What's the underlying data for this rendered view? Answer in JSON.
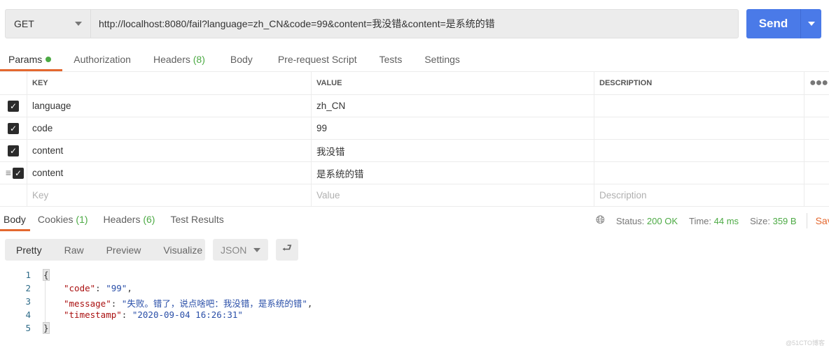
{
  "request": {
    "method": "GET",
    "url": "http://localhost:8080/fail?language=zh_CN&code=99&content=我没错&content=是系统的错",
    "send_label": "Send"
  },
  "req_tabs": [
    {
      "label": "Params",
      "active": true,
      "dot": true
    },
    {
      "label": "Authorization"
    },
    {
      "label": "Headers",
      "count": "(8)"
    },
    {
      "label": "Body"
    },
    {
      "label": "Pre-request Script"
    },
    {
      "label": "Tests"
    },
    {
      "label": "Settings"
    }
  ],
  "params": {
    "headers": {
      "key": "KEY",
      "value": "VALUE",
      "description": "DESCRIPTION"
    },
    "rows": [
      {
        "key": "language",
        "value": "zh_CN",
        "checked": true
      },
      {
        "key": "code",
        "value": "99",
        "checked": true
      },
      {
        "key": "content",
        "value": "我没错",
        "checked": true
      },
      {
        "key": "content",
        "value": "是系统的错",
        "checked": true
      }
    ],
    "placeholder": {
      "key": "Key",
      "value": "Value",
      "description": "Description"
    }
  },
  "resp_tabs": [
    {
      "label": "Body",
      "active": true
    },
    {
      "label": "Cookies",
      "count": "(1)"
    },
    {
      "label": "Headers",
      "count": "(6)"
    },
    {
      "label": "Test Results"
    }
  ],
  "status": {
    "status_label": "Status:",
    "status": "200 OK",
    "time_label": "Time:",
    "time": "44 ms",
    "size_label": "Size:",
    "size": "359 B",
    "save": "Save"
  },
  "view_modes": [
    "Pretty",
    "Raw",
    "Preview",
    "Visualize"
  ],
  "format": "JSON",
  "body": {
    "line_numbers": [
      "1",
      "2",
      "3",
      "4",
      "5"
    ],
    "open": "{",
    "close": "}",
    "fields": [
      {
        "key": "\"code\"",
        "value": "\"99\"",
        "sep": ","
      },
      {
        "key": "\"message\"",
        "value": "\"失败。错了，说点啥吧：我没错，是系统的错\"",
        "sep": ","
      },
      {
        "key": "\"timestamp\"",
        "value": "\"2020-09-04 16:26:31\"",
        "sep": ""
      }
    ]
  },
  "watermark": "@51CTO博客",
  "colors": {
    "accent": "#e4682f",
    "send": "#4a7ae8",
    "success": "#4caa44"
  }
}
